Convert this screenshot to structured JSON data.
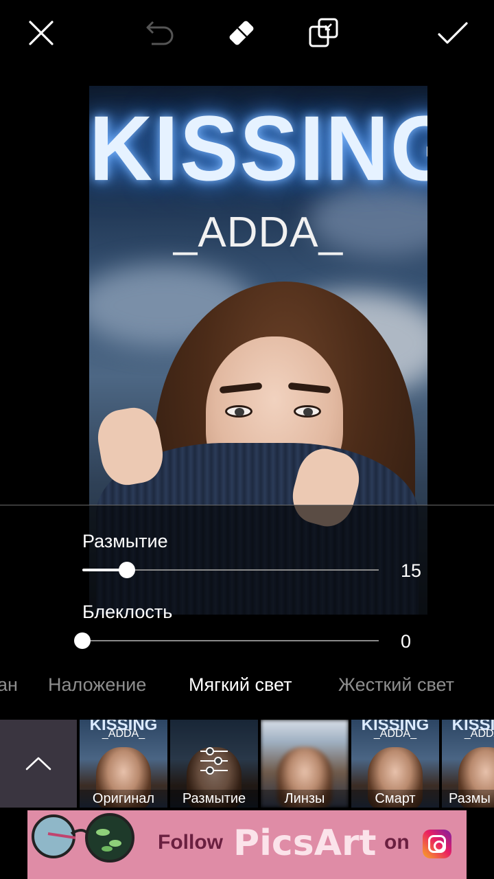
{
  "toolbar": {
    "close_icon": "close-icon",
    "undo_icon": "undo-icon",
    "eraser_icon": "eraser-icon",
    "compare_icon": "compare-icon",
    "apply_icon": "check-icon"
  },
  "canvas": {
    "title": "KISSING",
    "subtitle": "_ADDA_"
  },
  "sliders": {
    "blur": {
      "label": "Размытие",
      "value": "15",
      "fraction": 0.15
    },
    "fade": {
      "label": "Блеклость",
      "value": "0",
      "fraction": 0.0
    }
  },
  "blend_tabs": {
    "items": [
      "ан",
      "Наложение",
      "Мягкий свет",
      "Жесткий свет"
    ],
    "active": "Мягкий свет"
  },
  "effects": {
    "collapse_icon": "chevron-up-icon",
    "items": [
      {
        "label": "Оригинал",
        "thumb_title": "KISSING",
        "thumb_sub": "_ADDA_"
      },
      {
        "label": "Размытие",
        "selected": true
      },
      {
        "label": "Линзы"
      },
      {
        "label": "Смарт",
        "thumb_title": "KISSING",
        "thumb_sub": "_ADDA_"
      },
      {
        "label": "Размы",
        "thumb_title": "KISSING",
        "thumb_sub": "_ADDA_"
      }
    ]
  },
  "ad": {
    "follow": "Follow",
    "brand": "PicsArt",
    "on": "on",
    "icon": "instagram-icon"
  }
}
